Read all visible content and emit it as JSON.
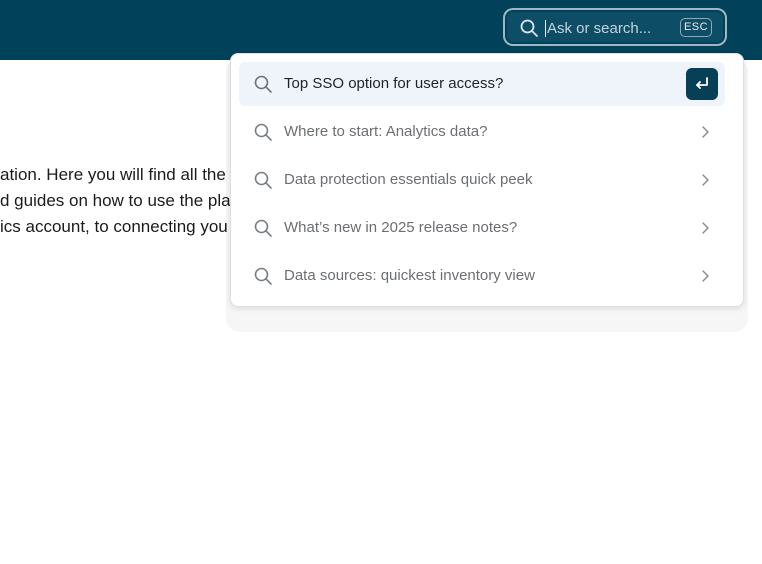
{
  "header": {
    "search": {
      "placeholder": "Ask or search...",
      "esc_label": "ESC"
    }
  },
  "content": {
    "lines": [
      "ation. Here you will find all the",
      "d guides on how to use the pla",
      "ics account, to connecting you"
    ]
  },
  "dropdown": {
    "items": [
      {
        "label": "Top SSO option for user access?",
        "icon": "search-icon",
        "action_icon": "enter-icon"
      },
      {
        "label": "Where to start: Analytics data?",
        "icon": "search-icon",
        "action_icon": "chevron-right-icon"
      },
      {
        "label": "Data protection essentials quick peek",
        "icon": "search-icon",
        "action_icon": "chevron-right-icon"
      },
      {
        "label": "What’s new in 2025 release notes?",
        "icon": "search-icon",
        "action_icon": "chevron-right-icon"
      },
      {
        "label": "Data sources: quickest inventory view",
        "icon": "search-icon",
        "action_icon": "chevron-right-icon"
      }
    ]
  },
  "colors": {
    "header_bg": "#02415a",
    "active_item_bg": "#eef4fa",
    "enter_button_bg": "#073f56"
  }
}
